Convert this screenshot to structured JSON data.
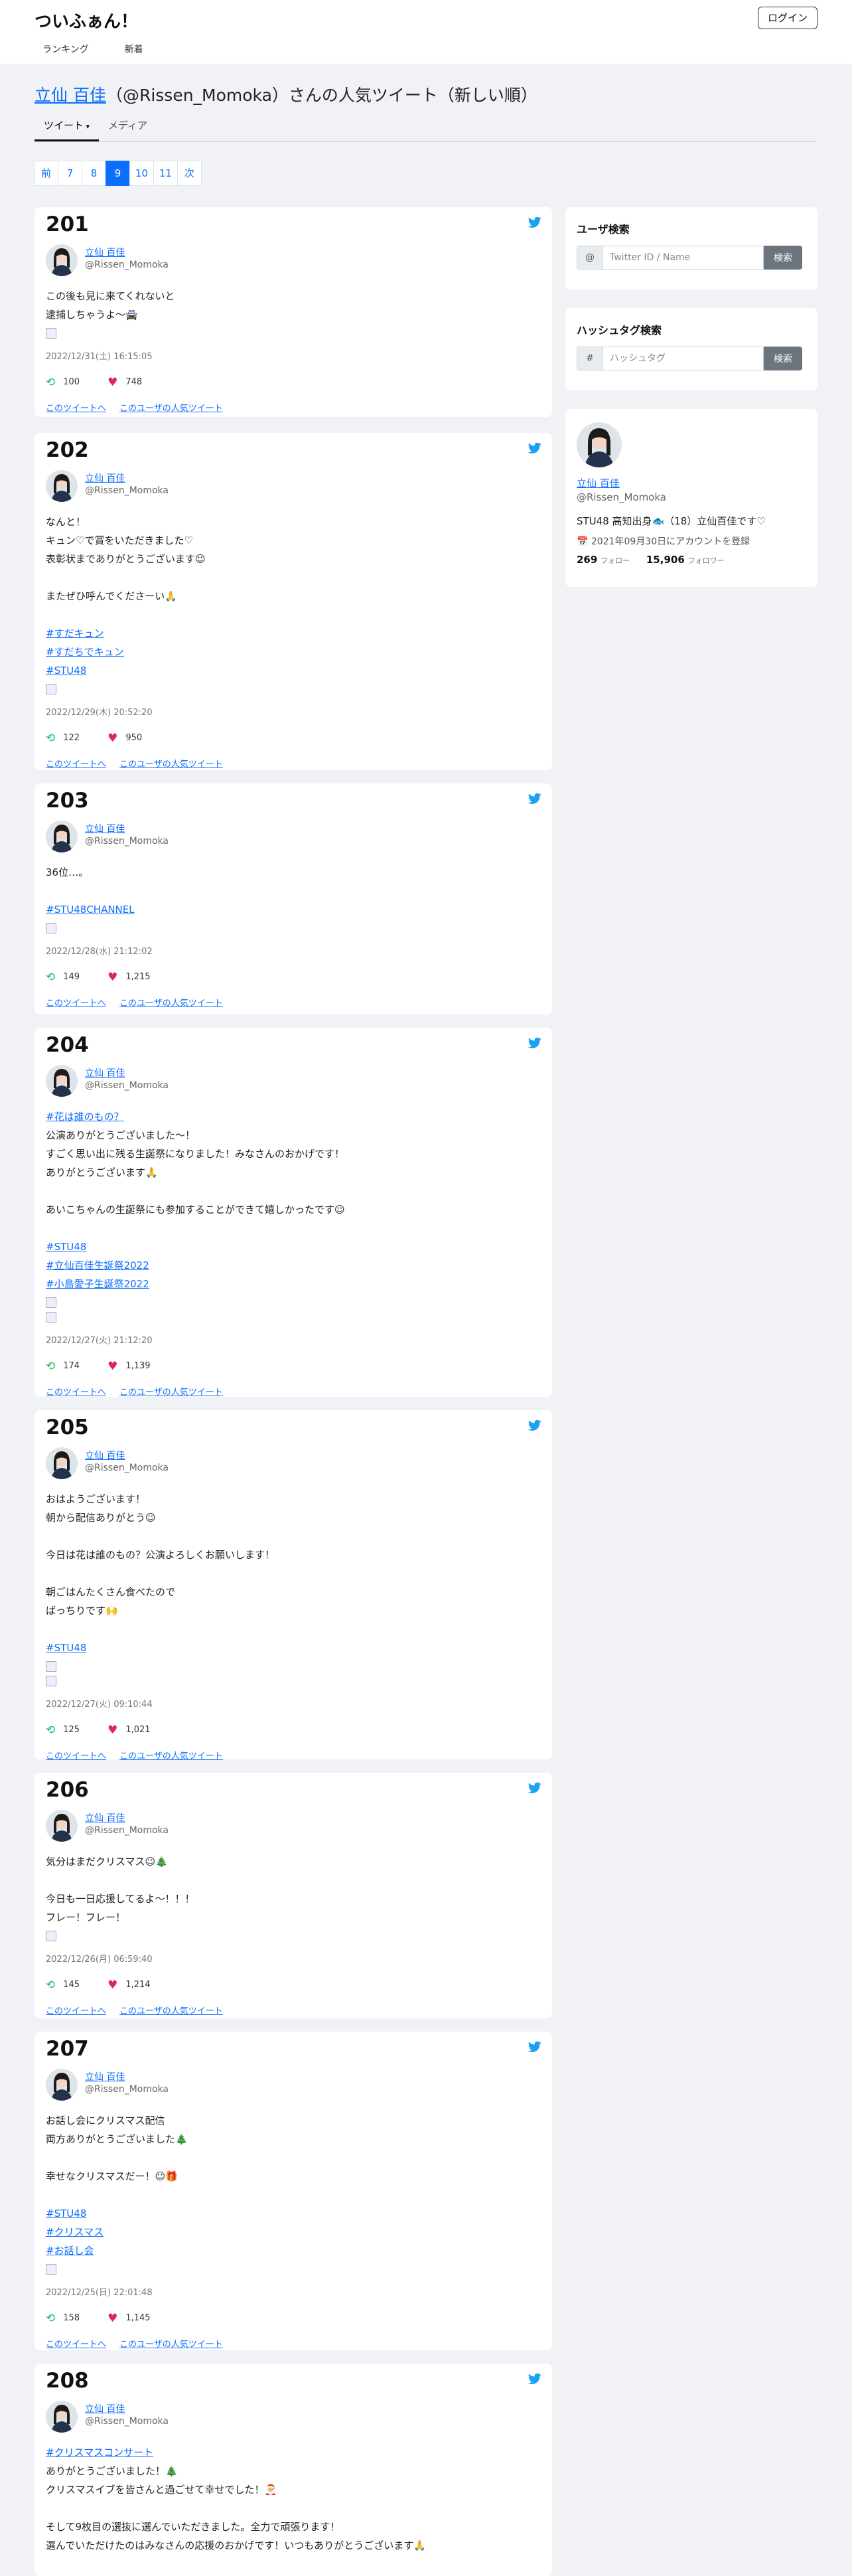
{
  "header": {
    "brand": "ついふぁん！",
    "login": "ログイン",
    "nav": [
      "ランキング",
      "新着"
    ]
  },
  "page": {
    "title_name": "立仙 百佳",
    "title_rest": "（@Rissen_Momoka）さんの人気ツイート（新しい順）",
    "tabs": [
      "ツイート",
      "メディア"
    ]
  },
  "pagination": [
    "前",
    "7",
    "8",
    "9",
    "10",
    "11",
    "次"
  ],
  "pagination_active": "9",
  "user": {
    "name": "立仙 百佳",
    "handle": "@Rissen_Momoka"
  },
  "links": {
    "tweet": "このツイートへ",
    "user": "このユーザの人気ツイート"
  },
  "tweets": [
    {
      "num": "201",
      "body": [
        {
          "t": "この後も見に来てくれないと"
        },
        {
          "t": "逮捕しちゃうよ〜🚔 "
        }
      ],
      "link": "twitter.com/Rissen_Momoka/…",
      "imgs": 1,
      "date": "2022/12/31(土) 16:15:05",
      "rt": "100",
      "like": "748"
    },
    {
      "num": "202",
      "body": [
        {
          "t": "なんと！"
        },
        {
          "t": "キュン♡で賞をいただきました♡"
        },
        {
          "t": "表彰状までありがとうございます☺"
        },
        {
          "t": ""
        },
        {
          "t": "またぜひ呼んでくださーい🙏"
        },
        {
          "t": ""
        },
        {
          "t": "#すだキュン",
          "h": true
        },
        {
          "t": "#すだちでキュン",
          "h": true
        },
        {
          "t": "#STU48",
          "h": true
        }
      ],
      "imgs": 1,
      "date": "2022/12/29(木) 20:52:20",
      "rt": "122",
      "like": "950"
    },
    {
      "num": "203",
      "body": [
        {
          "t": "36位…。"
        },
        {
          "t": ""
        },
        {
          "t": "#STU48CHANNEL",
          "h": true
        }
      ],
      "imgs": 1,
      "date": "2022/12/28(水) 21:12:02",
      "rt": "149",
      "like": "1,215"
    },
    {
      "num": "204",
      "body": [
        {
          "t": "#花は誰のもの？",
          "h": true,
          "tail": "？"
        },
        {
          "t": "公演ありがとうございました〜！"
        },
        {
          "t": "すごく思い出に残る生誕祭になりました！みなさんのおかげです！"
        },
        {
          "t": "ありがとうございます🙏"
        },
        {
          "t": ""
        },
        {
          "t": "あいこちゃんの生誕祭にも参加することができて嬉しかったです☺"
        },
        {
          "t": ""
        },
        {
          "t": "#STU48",
          "h": true
        },
        {
          "t": "#立仙百佳生誕祭2022",
          "h": true
        },
        {
          "t": "#小島愛子生誕祭2022",
          "h": true
        }
      ],
      "imgs": 2,
      "date": "2022/12/27(火) 21:12:20",
      "rt": "174",
      "like": "1,139"
    },
    {
      "num": "205",
      "body": [
        {
          "t": "おはようございます！"
        },
        {
          "t": "朝から配信ありがとう☺"
        },
        {
          "t": ""
        },
        {
          "t": "今日は花は誰のもの？公演よろしくお願いします！"
        },
        {
          "t": ""
        },
        {
          "t": "朝ごはんたくさん食べたので"
        },
        {
          "t": "ばっちりです🙌"
        },
        {
          "t": ""
        },
        {
          "t": "#STU48",
          "h": true
        }
      ],
      "imgs": 2,
      "date": "2022/12/27(火) 09:10:44",
      "rt": "125",
      "like": "1,021"
    },
    {
      "num": "206",
      "body": [
        {
          "t": "気分はまだクリスマス☺🎄"
        },
        {
          "t": ""
        },
        {
          "t": "今日も一日応援してるよ〜！！！"
        },
        {
          "t": "フレー！フレー！"
        }
      ],
      "imgs": 1,
      "date": "2022/12/26(月) 06:59:40",
      "rt": "145",
      "like": "1,214"
    },
    {
      "num": "207",
      "body": [
        {
          "t": "お話し会にクリスマス配信"
        },
        {
          "t": "両方ありがとうございました🎄"
        },
        {
          "t": ""
        },
        {
          "t": "幸せなクリスマスだー！☺🎁"
        },
        {
          "t": ""
        },
        {
          "t": "#STU48",
          "h": true
        },
        {
          "t": "#クリスマス",
          "h": true
        },
        {
          "t": "#お話し会",
          "h": true
        }
      ],
      "imgs": 1,
      "date": "2022/12/25(日) 22:01:48",
      "rt": "158",
      "like": "1,145"
    },
    {
      "num": "208",
      "body": [
        {
          "t": "#クリスマスコンサート",
          "h": true
        },
        {
          "t": "ありがとうございました！🎄"
        },
        {
          "t": "クリスマスイブを皆さんと過ごせて幸せでした！🎅"
        },
        {
          "t": ""
        },
        {
          "t": "そして9枚目の選抜に選んでいただきました。全力で頑張ります！"
        },
        {
          "t": "選んでいただけたのはみなさんの応援のおかげです！いつもありがとうございます🙏"
        }
      ],
      "imgs": 0,
      "date": "",
      "rt": "",
      "like": ""
    }
  ],
  "sidebar": {
    "user_search_title": "ユーザ検索",
    "user_search_prefix": "@",
    "user_search_placeholder": "Twitter ID / Name",
    "search_btn": "検索",
    "hashtag_title": "ハッシュタグ検索",
    "hashtag_prefix": "#",
    "hashtag_placeholder": "ハッシュタグ",
    "profile": {
      "name": "立仙 百佳",
      "handle": "@Rissen_Momoka",
      "bio": "STU48 高知出身🐟（18）立仙百佳です♡",
      "registered": "2021年09月30日にアカウントを登録",
      "follow_count": "269",
      "follow_label": "フォロー",
      "follower_count": "15,906",
      "follower_label": "フォロワー"
    }
  },
  "colors": {
    "accent": "#0d6efd",
    "retweet": "#17bf63",
    "like": "#e0245e",
    "twitter": "#1da1f2"
  }
}
